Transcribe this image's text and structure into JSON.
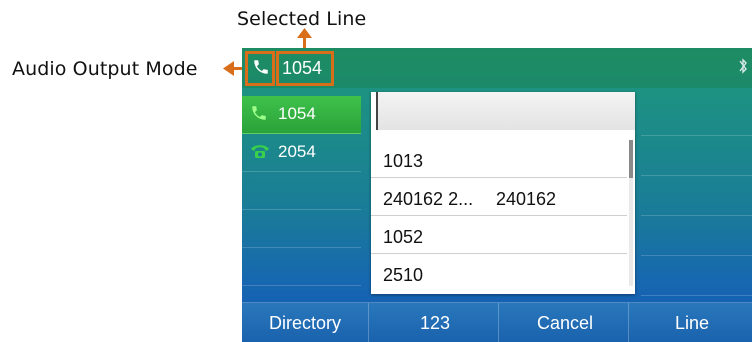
{
  "annotations": {
    "selected_line": "Selected Line",
    "audio_output_mode": "Audio Output Mode"
  },
  "status_bar": {
    "line_number": "1054",
    "audio_icon": "handset-icon",
    "right_icon": "bluetooth-icon"
  },
  "line_keys": [
    {
      "label": "1054",
      "icon": "handset-icon",
      "active": true
    },
    {
      "label": "2054",
      "icon": "desk-phone-icon",
      "active": false
    }
  ],
  "dropdown": {
    "input_value": "",
    "items": [
      {
        "col1": "1013",
        "col2": ""
      },
      {
        "col1": "240162 2...",
        "col2": "240162"
      },
      {
        "col1": "1052",
        "col2": ""
      },
      {
        "col1": "2510",
        "col2": ""
      }
    ]
  },
  "softkeys": [
    "Directory",
    "123",
    "Cancel",
    "Line"
  ],
  "colors": {
    "annotation": "#d86e1a",
    "active_line": "#2fa83b",
    "screen_top": "#1e8c62",
    "screen_bottom": "#1457b7"
  }
}
